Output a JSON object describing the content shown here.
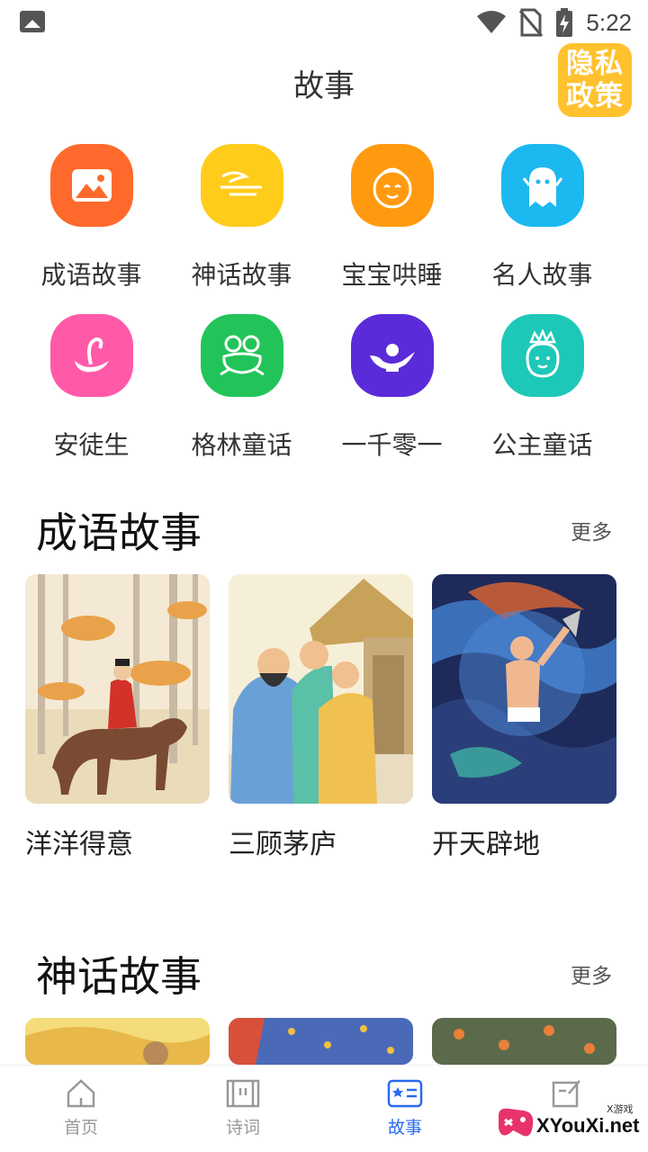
{
  "status_bar": {
    "time": "5:22"
  },
  "header": {
    "title": "故事",
    "privacy_badge": "隐私政策"
  },
  "categories": [
    {
      "label": "成语故事",
      "icon": "mountain-picture-icon",
      "color": "#ff6a2c"
    },
    {
      "label": "神话故事",
      "icon": "cloud-icon",
      "color": "#ffcc1c"
    },
    {
      "label": "宝宝哄睡",
      "icon": "baby-face-icon",
      "color": "#ff9a10"
    },
    {
      "label": "名人故事",
      "icon": "ghost-icon",
      "color": "#1cb8f0"
    },
    {
      "label": "安徒生",
      "icon": "swan-icon",
      "color": "#ff5aa8"
    },
    {
      "label": "格林童话",
      "icon": "frog-icon",
      "color": "#22c45a"
    },
    {
      "label": "一千零一",
      "icon": "magic-lamp-icon",
      "color": "#5a2bd8"
    },
    {
      "label": "公主童话",
      "icon": "princess-icon",
      "color": "#1ec8b8"
    }
  ],
  "sections": [
    {
      "title": "成语故事",
      "more": "更多",
      "cards": [
        {
          "title": "洋洋得意",
          "illustration": "rider-on-horse-in-birch-forest"
        },
        {
          "title": "三顾茅庐",
          "illustration": "three-men-at-thatched-hut"
        },
        {
          "title": "开天辟地",
          "illustration": "giant-with-axe-in-cosmic-swirl"
        }
      ]
    },
    {
      "title": "神话故事",
      "more": "更多",
      "cards": [
        {
          "illustration": "woman-among-golden-clouds"
        },
        {
          "illustration": "autumn-leaves-on-blue"
        },
        {
          "illustration": "fruit-tree"
        }
      ]
    }
  ],
  "bottom_nav": [
    {
      "label": "首页",
      "icon": "home-icon",
      "active": false
    },
    {
      "label": "诗词",
      "icon": "scroll-icon",
      "active": false
    },
    {
      "label": "故事",
      "icon": "story-book-icon",
      "active": true
    },
    {
      "label": "",
      "icon": "edit-note-icon",
      "active": false
    }
  ],
  "watermark": {
    "text": "XYouXi.net",
    "small": "X游戏"
  },
  "colors": {
    "accent": "#2a6bf0",
    "privacy": "#ffc22e"
  }
}
